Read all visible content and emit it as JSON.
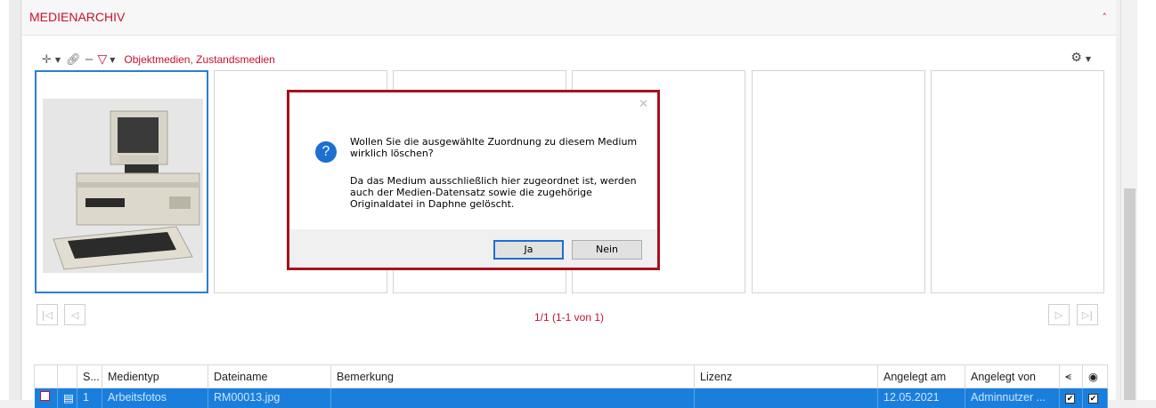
{
  "panel": {
    "title": "MEDIENARCHIV"
  },
  "toolbar": {
    "filter_text": "Objektmedien, Zustandsmedien"
  },
  "pager": {
    "text": "1/1 (1-1 von 1)"
  },
  "table": {
    "headers": [
      "",
      "",
      "S...",
      "Medientyp",
      "Dateiname",
      "Bemerkung",
      "Lizenz",
      "Angelegt am",
      "Angelegt von",
      "",
      ""
    ],
    "row": {
      "s": "1",
      "medientyp": "Arbeitsfotos",
      "dateiname": "RM00013.jpg",
      "bemerkung": "",
      "lizenz": "",
      "angelegt_am": "12.05.2021",
      "angelegt_von": "Adminnutzer ..."
    }
  },
  "dialog": {
    "message_1": "Wollen Sie die ausgewählte Zuordnung zu diesem Medium wirklich löschen?",
    "message_2": "Da das Medium ausschließlich hier zugeordnet ist, werden auch der Medien-Datensatz sowie die zugehörige Originaldatei in Daphne gelöscht.",
    "yes_label": "Ja",
    "no_label": "Nein"
  },
  "colors": {
    "accent": "#c8102e",
    "selection": "#1a7fdc",
    "dialog_border": "#a8121c"
  }
}
